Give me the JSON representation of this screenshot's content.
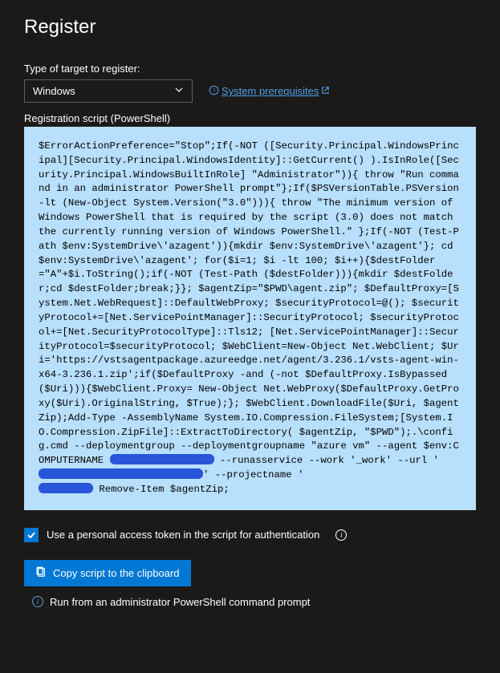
{
  "header": {
    "title": "Register"
  },
  "targetSection": {
    "label": "Type of target to register:",
    "selectedValue": "Windows",
    "prerequisitesLink": "System prerequisites",
    "prerequisitesPrefix": "?",
    "prerequisitesSuffixIcon": "external-link-icon"
  },
  "scriptSection": {
    "label": "Registration script (PowerShell)",
    "body_part1": "$ErrorActionPreference=\"Stop\";If(-NOT ([Security.Principal.WindowsPrincipal][Security.Principal.WindowsIdentity]::GetCurrent() ).IsInRole([Security.Principal.WindowsBuiltInRole] \"Administrator\")){ throw \"Run command in an administrator PowerShell prompt\"};If($PSVersionTable.PSVersion -lt (New-Object System.Version(\"3.0\"))){ throw \"The minimum version of Windows PowerShell that is required by the script (3.0) does not match the currently running version of Windows PowerShell.\" };If(-NOT (Test-Path $env:SystemDrive\\'azagent')){mkdir $env:SystemDrive\\'azagent'}; cd $env:SystemDrive\\'azagent'; for($i=1; $i -lt 100; $i++){$destFolder=\"A\"+$i.ToString();if(-NOT (Test-Path ($destFolder))){mkdir $destFolder;cd $destFolder;break;}}; $agentZip=\"$PWD\\agent.zip\"; $DefaultProxy=[System.Net.WebRequest]::DefaultWebProxy; $securityProtocol=@(); $securityProtocol+=[Net.ServicePointManager]::SecurityProtocol; $securityProtocol+=[Net.SecurityProtocolType]::Tls12; [Net.ServicePointManager]::SecurityProtocol=$securityProtocol; $WebClient=New-Object Net.WebClient; $Uri='https://vstsagentpackage.azureedge.net/agent/3.236.1/vsts-agent-win-x64-3.236.1.zip';if($DefaultProxy -and (-not $DefaultProxy.IsBypassed($Uri))){$WebClient.Proxy= New-Object Net.WebProxy($DefaultProxy.GetProxy($Uri).OriginalString, $True);}; $WebClient.DownloadFile($Uri, $agentZip);Add-Type -AssemblyName System.IO.Compression.FileSystem;[System.IO.Compression.ZipFile]::ExtractToDirectory( $agentZip, \"$PWD\");.\\config.cmd --deploymentgroup --deploymentgroupname \"azure vm\" --agent $env:COMPUTERNAME ",
    "body_part2": "--runasservice --work '_work' --url '",
    "body_part3": "' --projectname '",
    "body_part4": " Remove-Item $agentZip;"
  },
  "auth": {
    "checkboxLabel": "Use a personal access token in the script for authentication",
    "checked": true
  },
  "actions": {
    "copyLabel": "Copy script to the clipboard"
  },
  "hint": {
    "text": "Run from an administrator PowerShell command prompt"
  }
}
